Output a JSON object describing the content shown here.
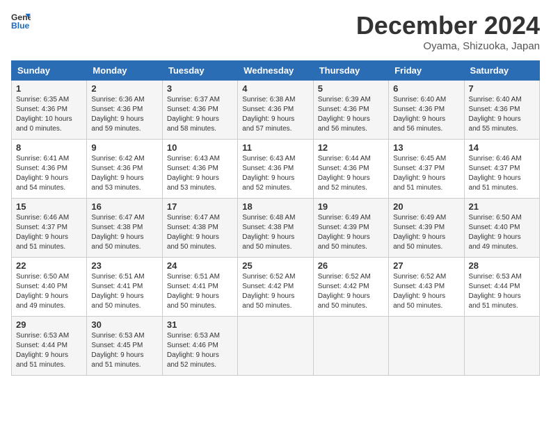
{
  "header": {
    "logo_line1": "General",
    "logo_line2": "Blue",
    "month": "December 2024",
    "location": "Oyama, Shizuoka, Japan"
  },
  "weekdays": [
    "Sunday",
    "Monday",
    "Tuesday",
    "Wednesday",
    "Thursday",
    "Friday",
    "Saturday"
  ],
  "weeks": [
    [
      {
        "day": "1",
        "sunrise": "6:35 AM",
        "sunset": "4:36 PM",
        "daylight": "10 hours and 0 minutes."
      },
      {
        "day": "2",
        "sunrise": "6:36 AM",
        "sunset": "4:36 PM",
        "daylight": "9 hours and 59 minutes."
      },
      {
        "day": "3",
        "sunrise": "6:37 AM",
        "sunset": "4:36 PM",
        "daylight": "9 hours and 58 minutes."
      },
      {
        "day": "4",
        "sunrise": "6:38 AM",
        "sunset": "4:36 PM",
        "daylight": "9 hours and 57 minutes."
      },
      {
        "day": "5",
        "sunrise": "6:39 AM",
        "sunset": "4:36 PM",
        "daylight": "9 hours and 56 minutes."
      },
      {
        "day": "6",
        "sunrise": "6:40 AM",
        "sunset": "4:36 PM",
        "daylight": "9 hours and 56 minutes."
      },
      {
        "day": "7",
        "sunrise": "6:40 AM",
        "sunset": "4:36 PM",
        "daylight": "9 hours and 55 minutes."
      }
    ],
    [
      {
        "day": "8",
        "sunrise": "6:41 AM",
        "sunset": "4:36 PM",
        "daylight": "9 hours and 54 minutes."
      },
      {
        "day": "9",
        "sunrise": "6:42 AM",
        "sunset": "4:36 PM",
        "daylight": "9 hours and 53 minutes."
      },
      {
        "day": "10",
        "sunrise": "6:43 AM",
        "sunset": "4:36 PM",
        "daylight": "9 hours and 53 minutes."
      },
      {
        "day": "11",
        "sunrise": "6:43 AM",
        "sunset": "4:36 PM",
        "daylight": "9 hours and 52 minutes."
      },
      {
        "day": "12",
        "sunrise": "6:44 AM",
        "sunset": "4:36 PM",
        "daylight": "9 hours and 52 minutes."
      },
      {
        "day": "13",
        "sunrise": "6:45 AM",
        "sunset": "4:37 PM",
        "daylight": "9 hours and 51 minutes."
      },
      {
        "day": "14",
        "sunrise": "6:46 AM",
        "sunset": "4:37 PM",
        "daylight": "9 hours and 51 minutes."
      }
    ],
    [
      {
        "day": "15",
        "sunrise": "6:46 AM",
        "sunset": "4:37 PM",
        "daylight": "9 hours and 51 minutes."
      },
      {
        "day": "16",
        "sunrise": "6:47 AM",
        "sunset": "4:38 PM",
        "daylight": "9 hours and 50 minutes."
      },
      {
        "day": "17",
        "sunrise": "6:47 AM",
        "sunset": "4:38 PM",
        "daylight": "9 hours and 50 minutes."
      },
      {
        "day": "18",
        "sunrise": "6:48 AM",
        "sunset": "4:38 PM",
        "daylight": "9 hours and 50 minutes."
      },
      {
        "day": "19",
        "sunrise": "6:49 AM",
        "sunset": "4:39 PM",
        "daylight": "9 hours and 50 minutes."
      },
      {
        "day": "20",
        "sunrise": "6:49 AM",
        "sunset": "4:39 PM",
        "daylight": "9 hours and 50 minutes."
      },
      {
        "day": "21",
        "sunrise": "6:50 AM",
        "sunset": "4:40 PM",
        "daylight": "9 hours and 49 minutes."
      }
    ],
    [
      {
        "day": "22",
        "sunrise": "6:50 AM",
        "sunset": "4:40 PM",
        "daylight": "9 hours and 49 minutes."
      },
      {
        "day": "23",
        "sunrise": "6:51 AM",
        "sunset": "4:41 PM",
        "daylight": "9 hours and 50 minutes."
      },
      {
        "day": "24",
        "sunrise": "6:51 AM",
        "sunset": "4:41 PM",
        "daylight": "9 hours and 50 minutes."
      },
      {
        "day": "25",
        "sunrise": "6:52 AM",
        "sunset": "4:42 PM",
        "daylight": "9 hours and 50 minutes."
      },
      {
        "day": "26",
        "sunrise": "6:52 AM",
        "sunset": "4:42 PM",
        "daylight": "9 hours and 50 minutes."
      },
      {
        "day": "27",
        "sunrise": "6:52 AM",
        "sunset": "4:43 PM",
        "daylight": "9 hours and 50 minutes."
      },
      {
        "day": "28",
        "sunrise": "6:53 AM",
        "sunset": "4:44 PM",
        "daylight": "9 hours and 51 minutes."
      }
    ],
    [
      {
        "day": "29",
        "sunrise": "6:53 AM",
        "sunset": "4:44 PM",
        "daylight": "9 hours and 51 minutes."
      },
      {
        "day": "30",
        "sunrise": "6:53 AM",
        "sunset": "4:45 PM",
        "daylight": "9 hours and 51 minutes."
      },
      {
        "day": "31",
        "sunrise": "6:53 AM",
        "sunset": "4:46 PM",
        "daylight": "9 hours and 52 minutes."
      },
      null,
      null,
      null,
      null
    ]
  ]
}
